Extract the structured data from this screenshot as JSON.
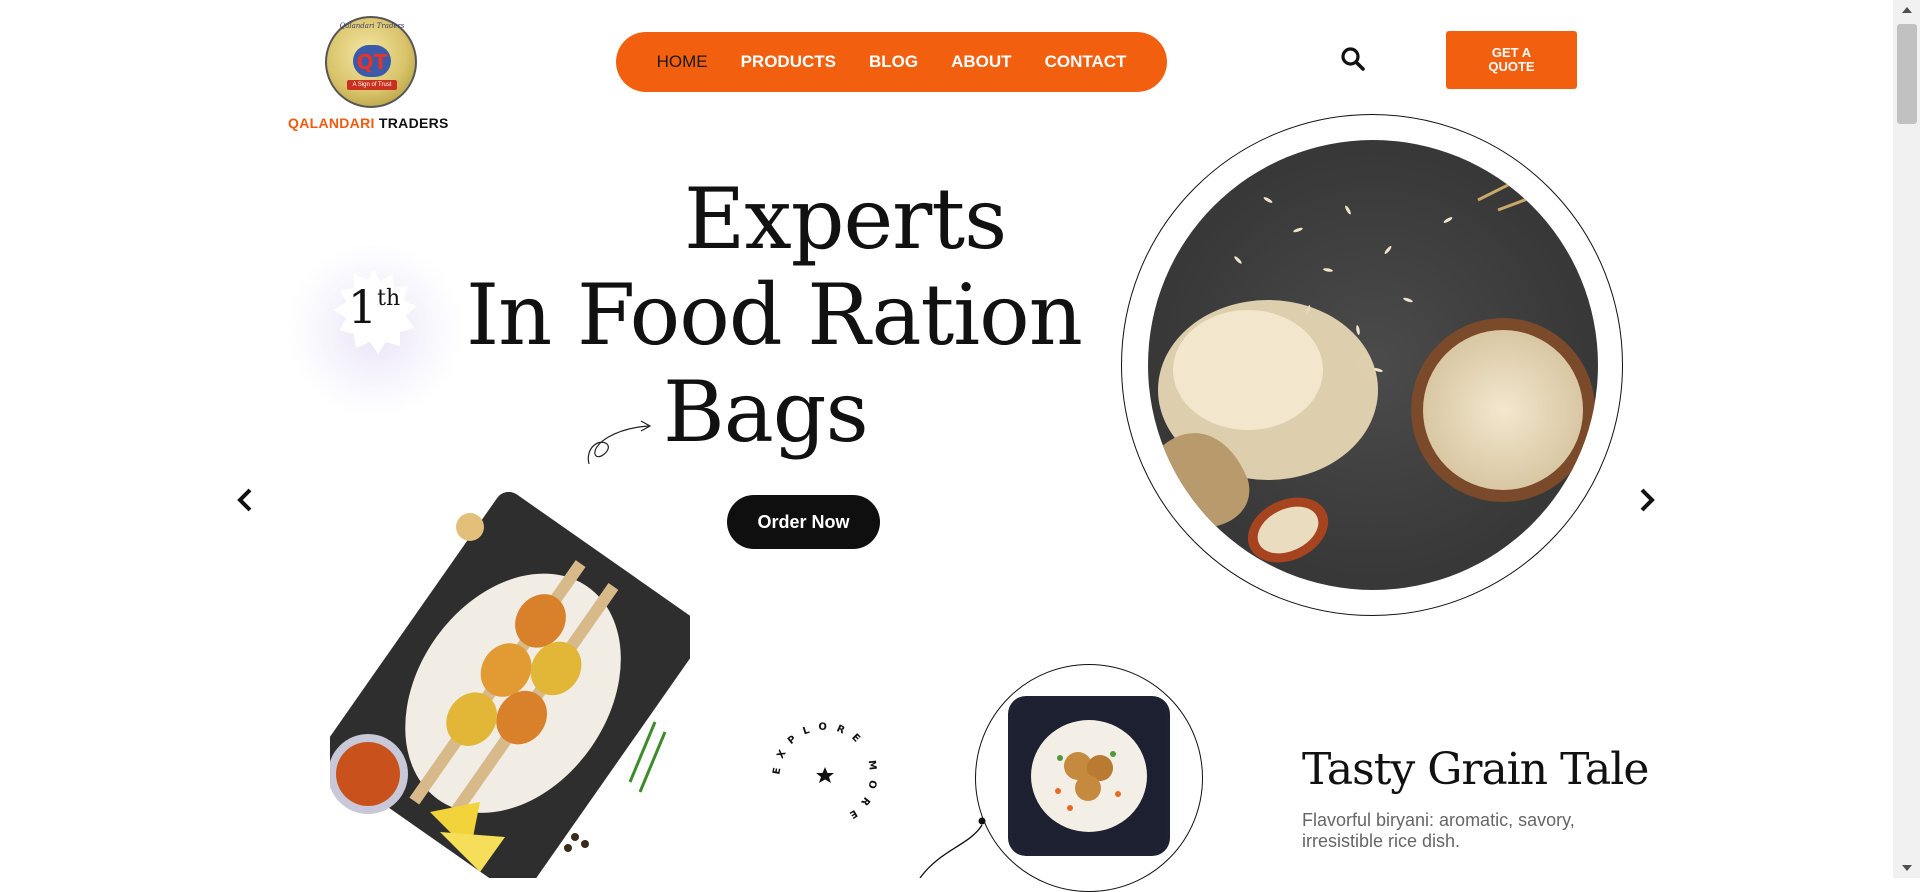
{
  "header": {
    "logo": {
      "arc_text": "Qalandari Traders",
      "ribbon_text": "A Sign of Trust",
      "initials": "QT"
    },
    "brand": {
      "part1": "QALANDARI",
      "part2": "TRADERS"
    },
    "nav": [
      {
        "label": "HOME",
        "active": true
      },
      {
        "label": "PRODUCTS",
        "active": false
      },
      {
        "label": "BLOG",
        "active": false
      },
      {
        "label": "ABOUT",
        "active": false
      },
      {
        "label": "CONTACT",
        "active": false
      }
    ],
    "search_icon": "search-icon",
    "quote_button": {
      "line1": "GET A",
      "line2": "QUOTE"
    }
  },
  "hero": {
    "badge": {
      "number": "1",
      "suffix": "th"
    },
    "headline": {
      "line1": "Experts",
      "line2": "In Food Ration",
      "line3": "Bags"
    },
    "order_button": "Order Now",
    "prev_icon": "chevron-left-icon",
    "next_icon": "chevron-right-icon"
  },
  "lower": {
    "explore_text": "EXPLORE MORE",
    "tale_title": "Tasty Grain Tale",
    "tale_desc": "Flavorful biryani: aromatic, savory, irresistible rice dish."
  },
  "colors": {
    "accent": "#f2600f",
    "dark": "#0f0f0f",
    "text_muted": "#666666"
  }
}
